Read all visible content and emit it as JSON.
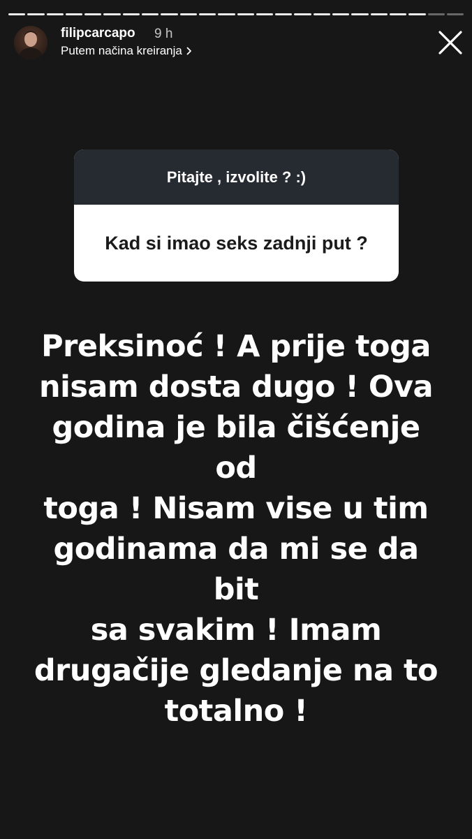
{
  "story": {
    "progress_segments": 24,
    "progress_completed": 22
  },
  "header": {
    "username": "filipcarcapo",
    "time": "9 h",
    "via_label": "Putem načina kreiranja",
    "chevron_icon": "chevron-right-icon",
    "close_icon": "close-icon"
  },
  "question_sticker": {
    "prompt": "Pitajte , izvolite ? :)",
    "question": "Kad si imao seks zadnji put ?"
  },
  "answer": {
    "lines": [
      "Preksinoć ! A prije toga",
      "nisam dosta dugo ! Ova",
      "godina je bila čišćenje od",
      "toga ! Nisam vise u tim",
      "godinama da mi se da bit",
      "sa svakim ! Imam",
      "drugačije gledanje na to",
      "totalno !"
    ]
  }
}
